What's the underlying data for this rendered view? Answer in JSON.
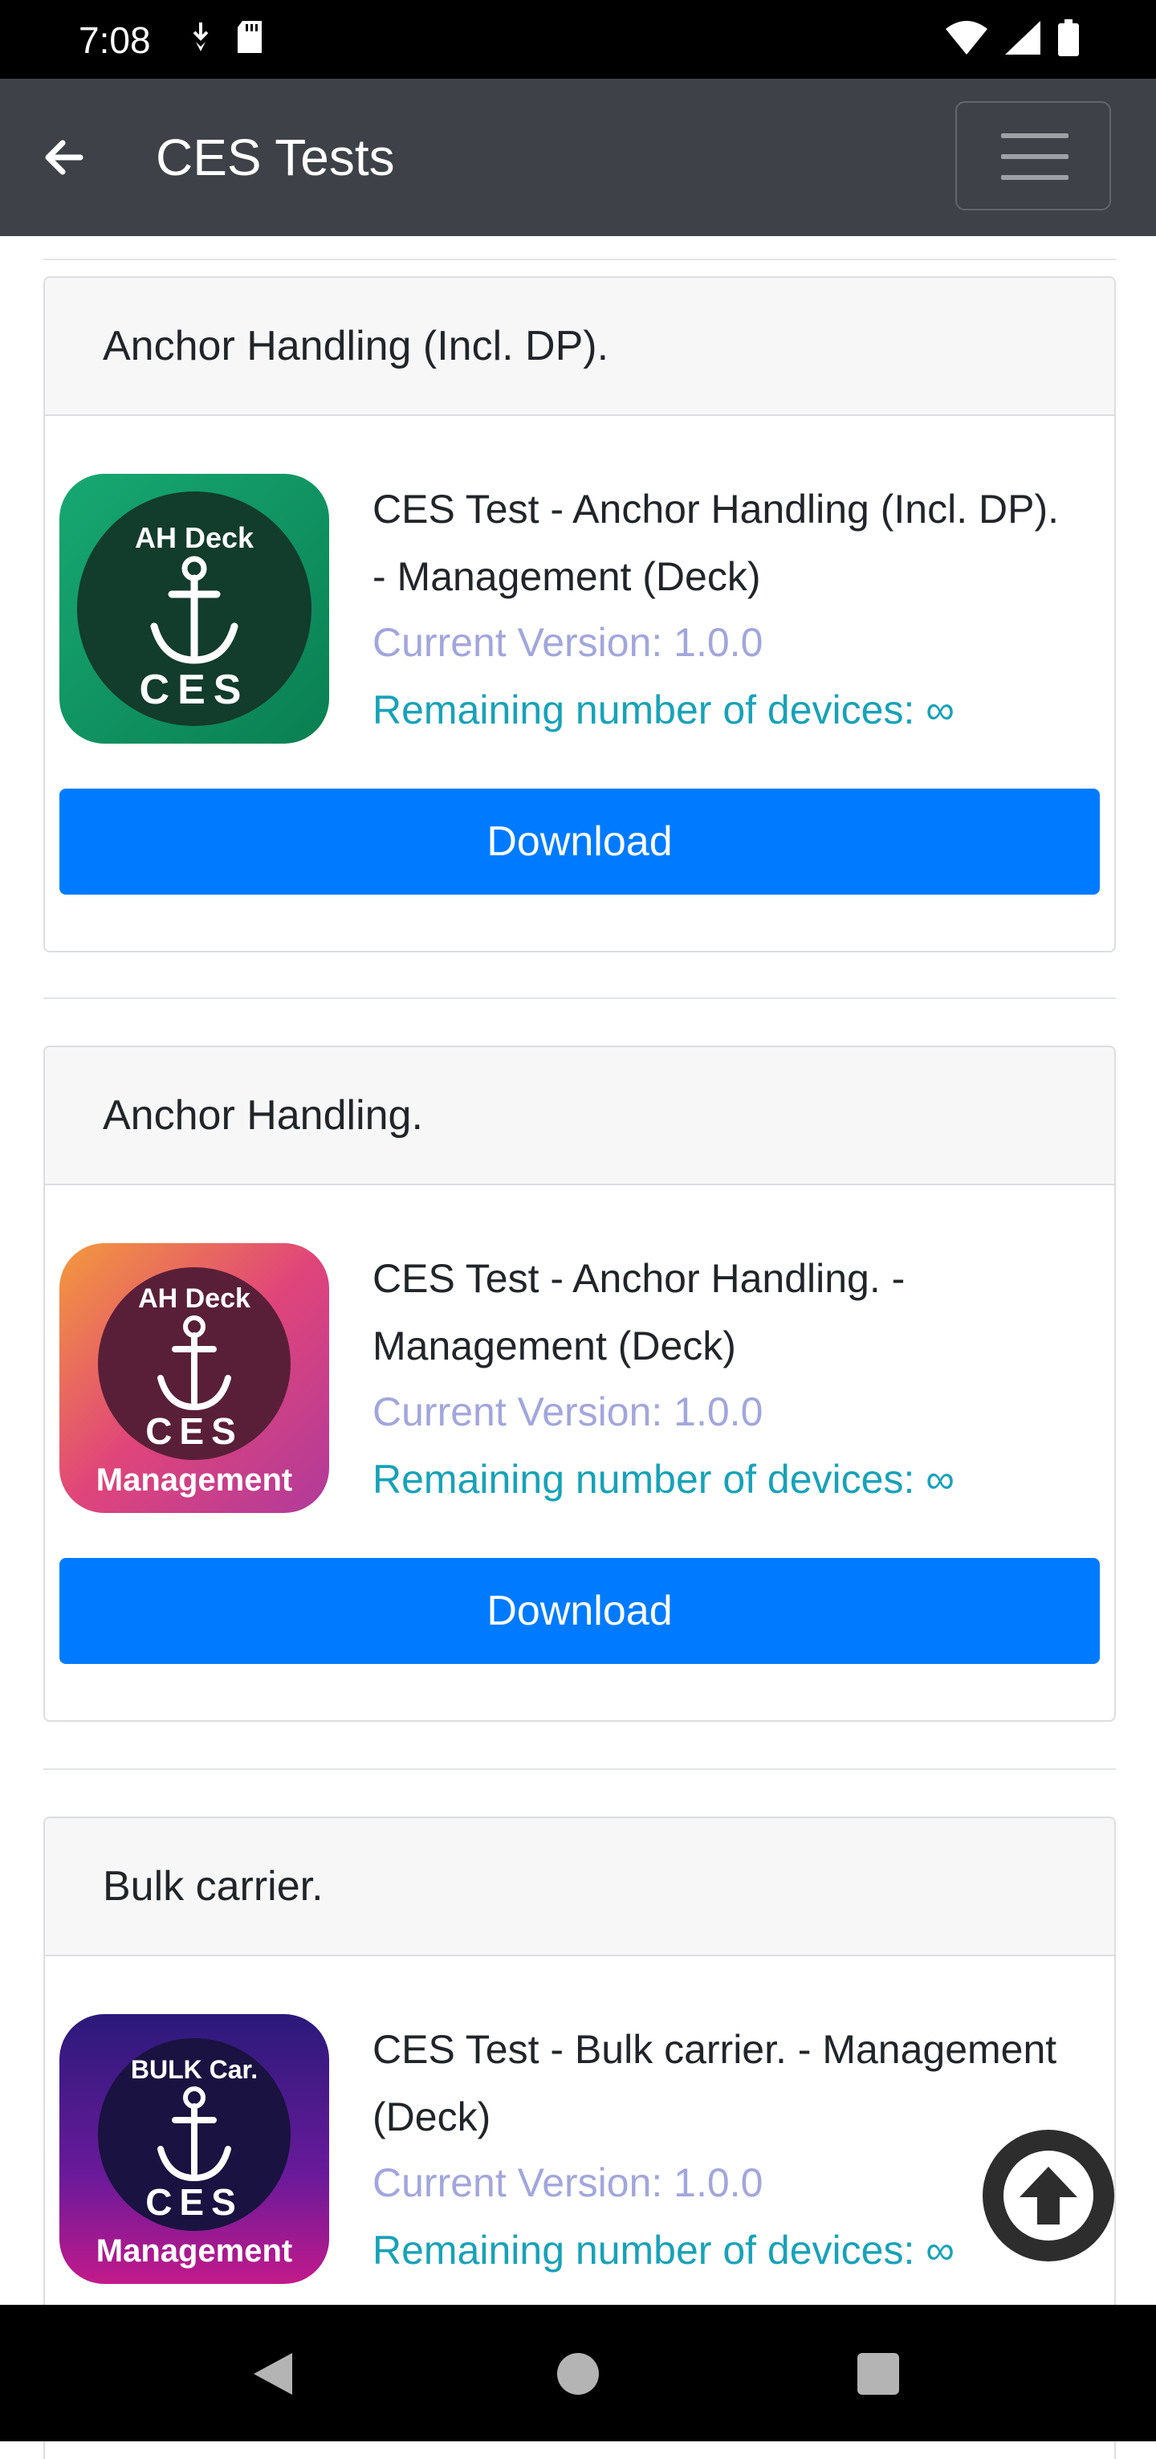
{
  "status_bar": {
    "time": "7:08"
  },
  "app_bar": {
    "title": "CES Tests"
  },
  "items": [
    {
      "header": "Anchor Handling (Incl. DP).",
      "title": "CES Test - Anchor Handling (Incl. DP). - Management (Deck)",
      "version": "Current Version: 1.0.0",
      "devices": "Remaining number of devices: ∞",
      "download": "Download",
      "icon": {
        "top_text": "AH Deck",
        "bottom_text": "CES",
        "extra_text": "",
        "color": "#0f9a6a"
      }
    },
    {
      "header": "Anchor Handling.",
      "title": "CES Test - Anchor Handling. - Management (Deck)",
      "version": "Current Version: 1.0.0",
      "devices": "Remaining number of devices: ∞",
      "download": "Download",
      "icon": {
        "top_text": "AH Deck",
        "bottom_text": "CES",
        "extra_text": "Management",
        "color": "#e0457a"
      }
    },
    {
      "header": "Bulk carrier.",
      "title": "CES Test - Bulk carrier. - Management (Deck)",
      "version": "Current Version: 1.0.0",
      "devices": "Remaining number of devices: ∞",
      "download": "Download",
      "icon": {
        "top_text": "BULK Car.",
        "bottom_text": "CES",
        "extra_text": "Management",
        "color": "#5a1a9a"
      }
    }
  ],
  "colors": {
    "accent": "#007bff",
    "app_bar": "#3e4248",
    "version_text": "#a2a6dc",
    "devices_text": "#17a2b8"
  }
}
